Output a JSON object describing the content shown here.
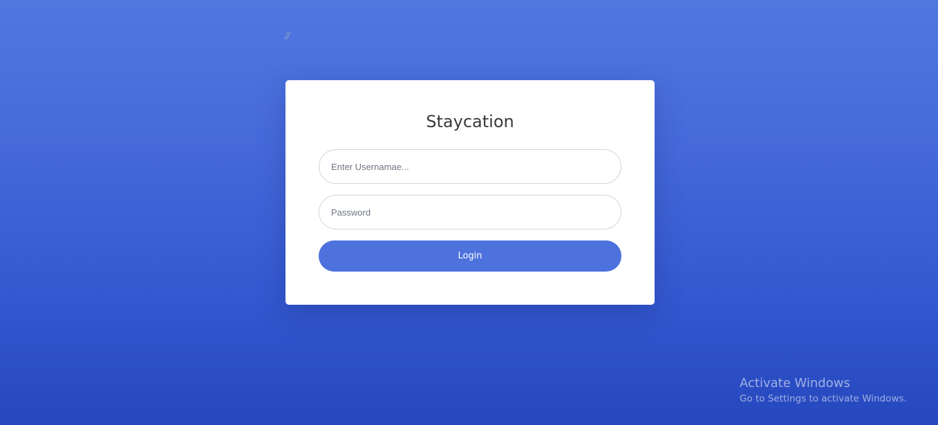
{
  "page": {
    "comment_mark": "//"
  },
  "login_card": {
    "title": "Staycation",
    "username_placeholder": "Enter Usernamae...",
    "username_value": "",
    "password_placeholder": "Password",
    "password_value": "",
    "login_label": "Login"
  },
  "watermark": {
    "title": "Activate Windows",
    "subtitle": "Go to Settings to activate Windows."
  },
  "colors": {
    "background_top": "#5078df",
    "background_bottom": "#2647be",
    "card": "#ffffff",
    "button": "#4d72de",
    "button_text": "#ffffff",
    "title_text": "#3a3a3a"
  }
}
